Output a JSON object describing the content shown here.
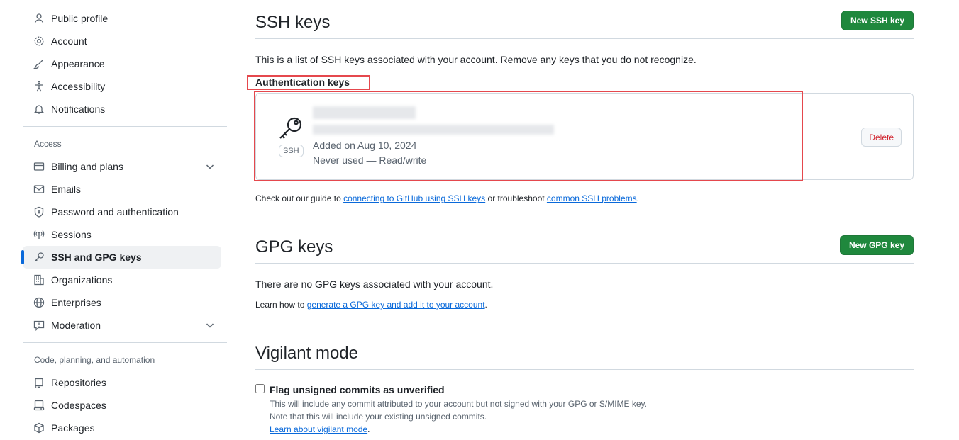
{
  "sidebar": {
    "items_top": [
      {
        "label": "Public profile",
        "icon": "person-icon"
      },
      {
        "label": "Account",
        "icon": "gear-icon"
      },
      {
        "label": "Appearance",
        "icon": "paintbrush-icon"
      },
      {
        "label": "Accessibility",
        "icon": "accessibility-icon"
      },
      {
        "label": "Notifications",
        "icon": "bell-icon"
      }
    ],
    "access_heading": "Access",
    "items_access": [
      {
        "label": "Billing and plans",
        "icon": "credit-card-icon"
      },
      {
        "label": "Emails",
        "icon": "mail-icon"
      },
      {
        "label": "Password and authentication",
        "icon": "shield-lock-icon"
      },
      {
        "label": "Sessions",
        "icon": "broadcast-icon"
      },
      {
        "label": "SSH and GPG keys",
        "icon": "key-icon"
      },
      {
        "label": "Organizations",
        "icon": "organization-icon"
      },
      {
        "label": "Enterprises",
        "icon": "globe-icon"
      },
      {
        "label": "Moderation",
        "icon": "report-icon"
      }
    ],
    "code_heading": "Code, planning, and automation",
    "items_code": [
      {
        "label": "Repositories",
        "icon": "repo-icon"
      },
      {
        "label": "Codespaces",
        "icon": "codespaces-icon"
      },
      {
        "label": "Packages",
        "icon": "package-icon"
      }
    ]
  },
  "ssh": {
    "title": "SSH keys",
    "new_button": "New SSH key",
    "description": "This is a list of SSH keys associated with your account. Remove any keys that you do not recognize.",
    "auth_heading": "Authentication keys",
    "key": {
      "badge": "SSH",
      "added": "Added on Aug 10, 2024",
      "usage": "Never used — Read/write",
      "delete": "Delete"
    },
    "guide_prefix": "Check out our guide to ",
    "guide_link1": "connecting to GitHub using SSH keys",
    "guide_mid": " or troubleshoot ",
    "guide_link2": "common SSH problems",
    "guide_suffix": "."
  },
  "gpg": {
    "title": "GPG keys",
    "new_button": "New GPG key",
    "empty": "There are no GPG keys associated with your account.",
    "learn_prefix": "Learn how to ",
    "learn_link": "generate a GPG key and add it to your account",
    "learn_suffix": "."
  },
  "vigilant": {
    "title": "Vigilant mode",
    "checkbox_label": "Flag unsigned commits as unverified",
    "note1": "This will include any commit attributed to your account but not signed with your GPG or S/MIME key.",
    "note2": "Note that this will include your existing unsigned commits.",
    "learn_link": "Learn about vigilant mode",
    "learn_suffix": "."
  },
  "colors": {
    "accent": "#0969da",
    "green": "#1f883d",
    "danger": "#d1242f",
    "annotation": "#e5484d"
  }
}
